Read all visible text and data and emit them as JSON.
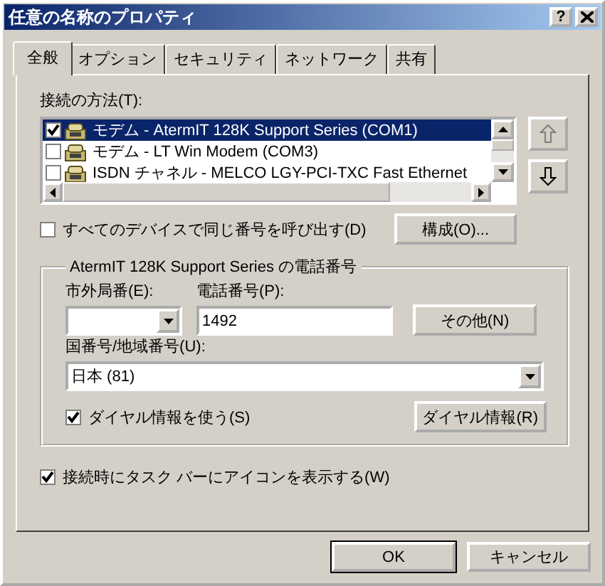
{
  "window": {
    "title": "任意の名称のプロパティ",
    "help_button": "?"
  },
  "tabs": [
    {
      "label": "全般",
      "selected": true
    },
    {
      "label": "オプション",
      "selected": false
    },
    {
      "label": "セキュリティ",
      "selected": false
    },
    {
      "label": "ネットワーク",
      "selected": false
    },
    {
      "label": "共有",
      "selected": false
    }
  ],
  "connect_using": {
    "label": "接続の方法(T):",
    "items": [
      {
        "label": "モデム - AtermIT 128K Support Series (COM1)",
        "checked": true,
        "selected": true
      },
      {
        "label": "モデム - LT Win Modem (COM3)",
        "checked": false,
        "selected": false
      },
      {
        "label": "ISDN チャネル - MELCO LGY-PCI-TXC Fast Ethernet",
        "checked": false,
        "selected": false
      }
    ]
  },
  "call_all_devices": {
    "label": "すべてのデバイスで同じ番号を呼び出す(D)",
    "checked": false
  },
  "configure_button": "構成(O)...",
  "phone_group": {
    "title": "AtermIT 128K Support Series の電話番号",
    "area_code": {
      "label": "市外局番(E):"
    },
    "phone_number": {
      "label": "電話番号(P):",
      "value": "1492"
    },
    "other_button": "その他(N)",
    "country": {
      "label": "国番号/地域番号(U):",
      "value": "日本 (81)"
    },
    "use_dialing_rules": {
      "label": "ダイヤル情報を使う(S)",
      "checked": true
    },
    "dialing_rules_button": "ダイヤル情報(R)"
  },
  "show_icon": {
    "label": "接続時にタスク バーにアイコンを表示する(W)",
    "checked": true
  },
  "buttons": [
    "OK",
    "キャンセル"
  ]
}
